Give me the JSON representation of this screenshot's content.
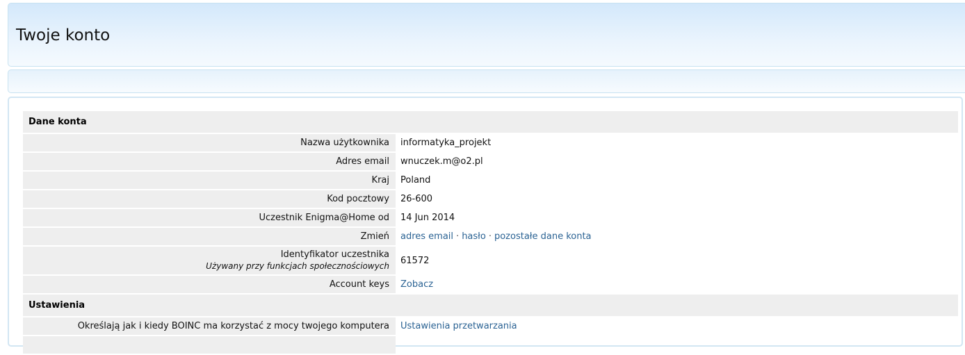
{
  "header": {
    "title": "Twoje konto"
  },
  "account_section": {
    "title": "Dane konta",
    "rows": {
      "username": {
        "label": "Nazwa użytkownika",
        "value": "informatyka_projekt"
      },
      "email": {
        "label": "Adres email",
        "value": "wnuczek.m@o2.pl"
      },
      "country": {
        "label": "Kraj",
        "value": "Poland"
      },
      "postal": {
        "label": "Kod pocztowy",
        "value": "26-600"
      },
      "member_since": {
        "label": "Uczestnik Enigma@Home od",
        "value": "14 Jun 2014"
      },
      "change": {
        "label": "Zmień",
        "links": {
          "email": "adres email",
          "password": "hasło",
          "other": "pozostałe dane konta"
        },
        "separator": "·"
      },
      "user_id": {
        "label": "Identyfikator uczestnika",
        "sublabel": "Używany przy funkcjach społecznościowych",
        "value": "61572"
      },
      "account_keys": {
        "label": "Account keys",
        "link": "Zobacz"
      }
    }
  },
  "settings_section": {
    "title": "Ustawienia",
    "rows": {
      "computing": {
        "label": "Określają jak i kiedy BOINC ma korzystać z mocy twojego komputera",
        "link": "Ustawienia przetwarzania"
      }
    }
  },
  "colors": {
    "link": "#2a6293",
    "row_bg": "#eeeeee",
    "header_gradient_top": "#d3e8fb"
  }
}
